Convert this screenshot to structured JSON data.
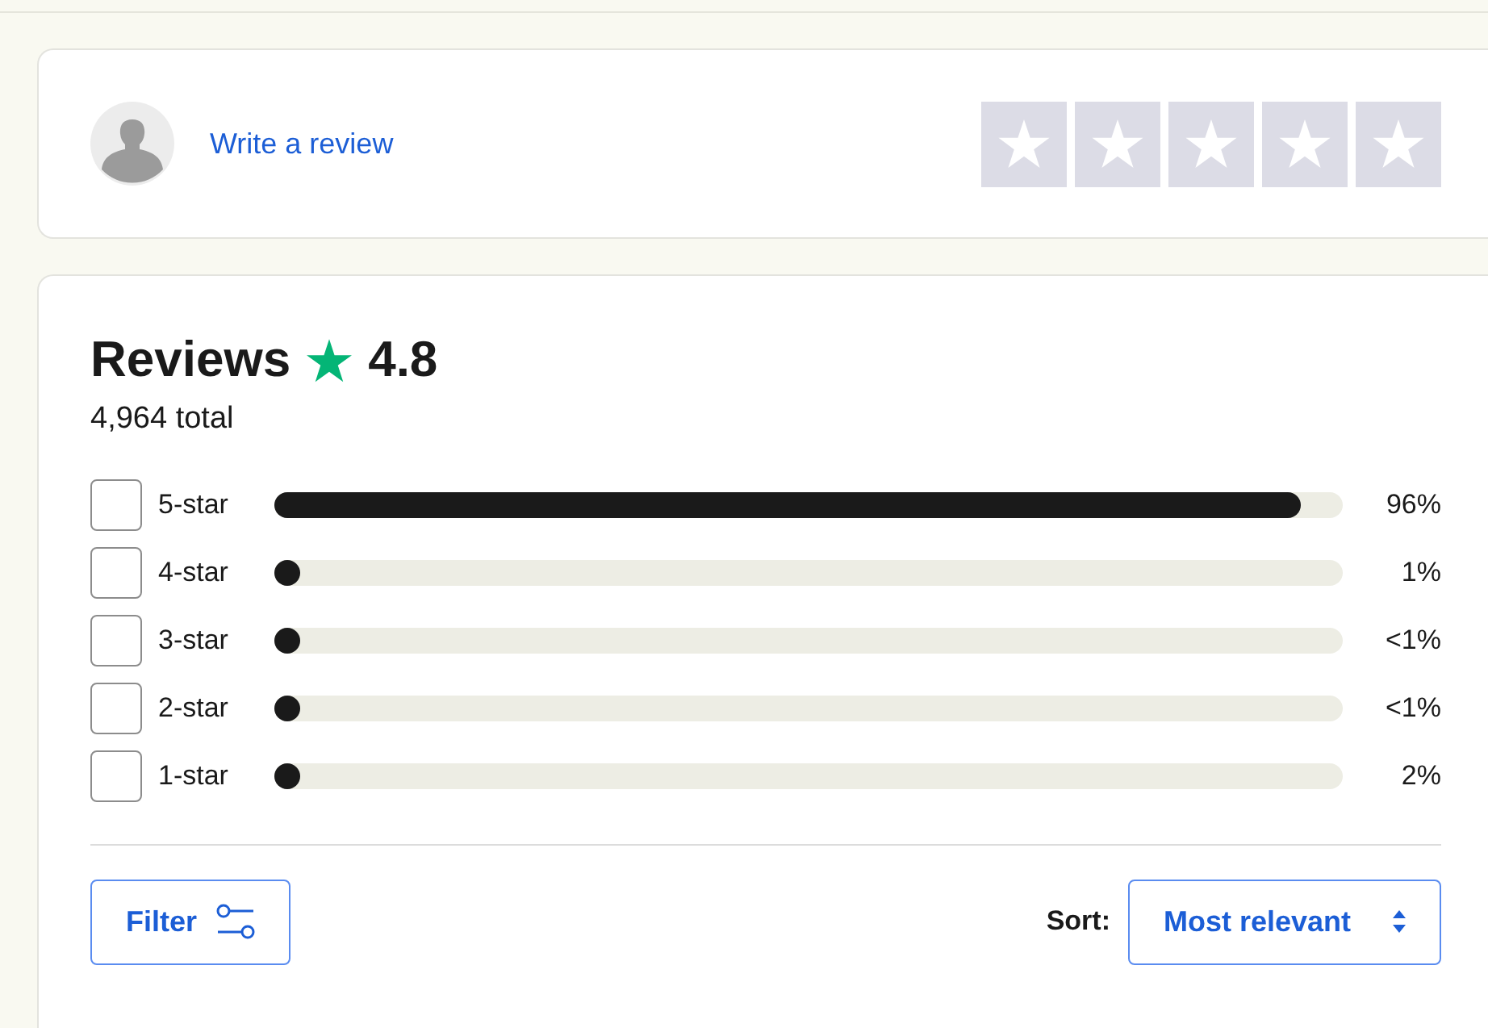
{
  "write_review": {
    "link": "Write a review",
    "stars": 0
  },
  "reviews": {
    "title": "Reviews",
    "rating": "4.8",
    "total": "4,964 total",
    "distribution": [
      {
        "label": "5-star",
        "checked": false,
        "level": 0.96,
        "percent": "96%"
      },
      {
        "label": "4-star",
        "checked": false,
        "level": 0.01,
        "percent": "1%"
      },
      {
        "label": "3-star",
        "checked": false,
        "level": 0.005,
        "percent": "<1%"
      },
      {
        "label": "2-star",
        "checked": false,
        "level": 0.005,
        "percent": "<1%"
      },
      {
        "label": "1-star",
        "checked": false,
        "level": 0.02,
        "percent": "2%"
      }
    ],
    "filter_button": "Filter",
    "sort_label": "Sort:",
    "sort_value": "Most relevant"
  }
}
